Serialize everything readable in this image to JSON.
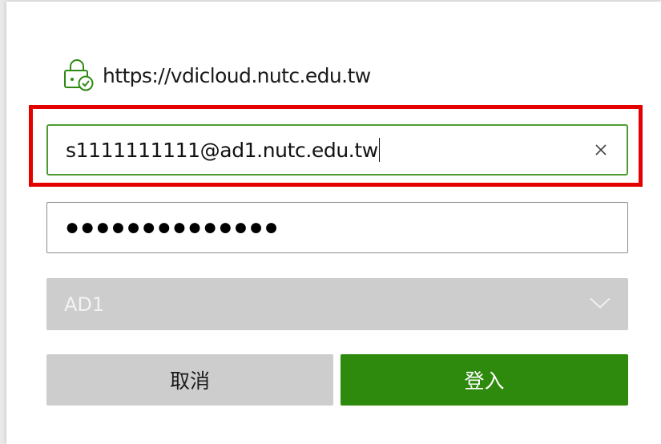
{
  "site": {
    "url": "https://vdicloud.nutc.edu.tw",
    "icon": "secure-lock-check-icon",
    "icon_color": "#2f8a14"
  },
  "login": {
    "username_value": "s1111111111@ad1.nutc.edu.tw",
    "password_mask": "●●●●●●●●●●●●●●",
    "domain_selected": "AD1",
    "cancel_label": "取消",
    "login_label": "登入"
  },
  "colors": {
    "accent": "#2d8a0c",
    "focus_border": "#4f9b33",
    "highlight": "#e50000",
    "disabled": "#cdcdcd"
  }
}
